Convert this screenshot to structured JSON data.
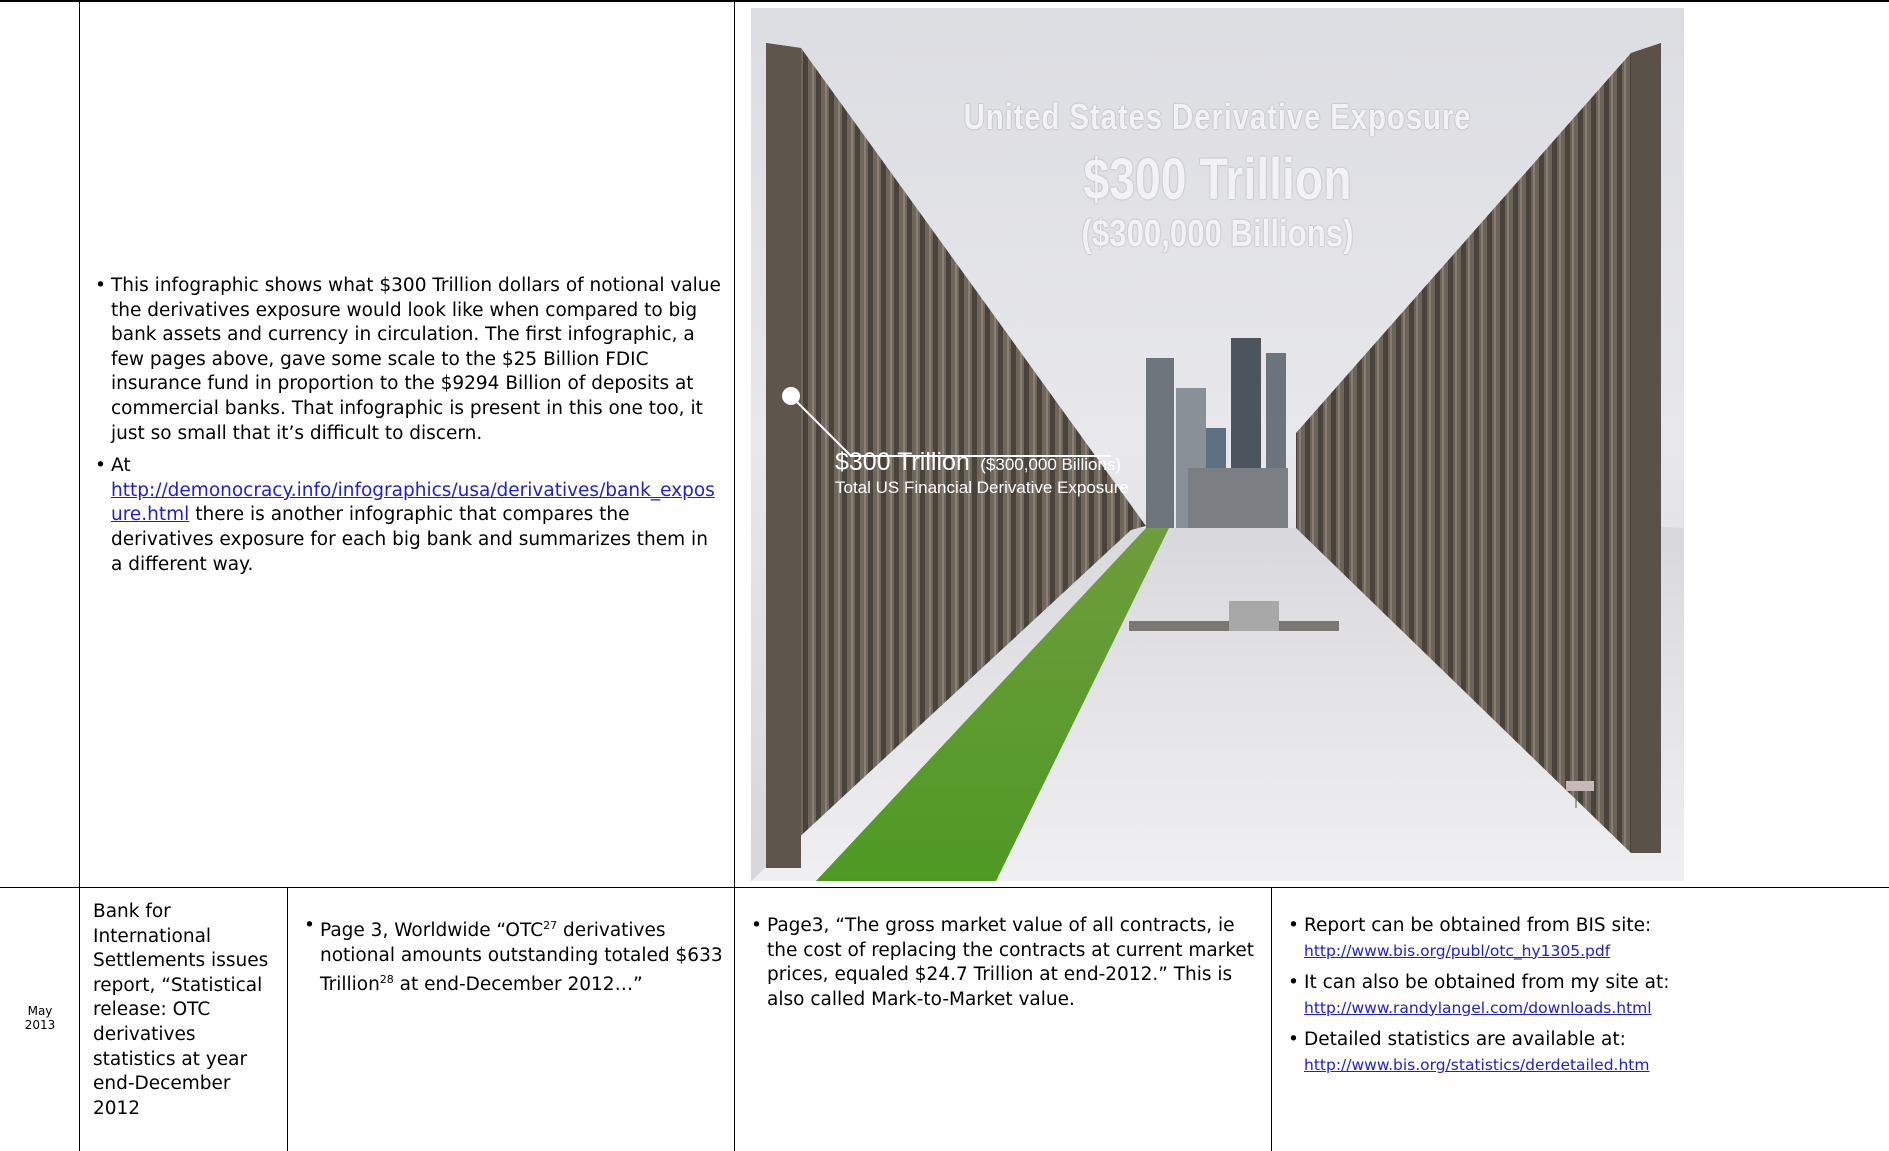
{
  "row1": {
    "bullets": [
      "This infographic shows what $300 Trillion dollars of notional value the derivatives exposure would look like when compared to big bank assets and currency in circulation. The first infographic, a few pages above, gave some scale to the $25 Billion FDIC insurance fund in proportion to the $9294 Billion of deposits at commercial banks. That infographic is present in this one too, it just so small that it’s difficult to discern."
    ],
    "bullet2_prefix": "At",
    "bullet2_link": "http://demonocracy.info/infographics/usa/derivatives/bank_exposure.html",
    "bullet2_suffix": " there is another infographic that compares the derivatives exposure for each big bank and summarizes them in a different way."
  },
  "infographic": {
    "title": "United States Derivative Exposure",
    "amount": "$300 Trillion",
    "amount_billions": "($300,000 Billions)",
    "callout_amount": "$300 Trillion",
    "callout_billions": "($300,000 Billions)",
    "callout_desc": "Total US Financial Derivative Exposure"
  },
  "row2": {
    "date_month": "May",
    "date_year": "2013",
    "event": "Bank for International Settlements issues report, “Statistical release: OTC derivatives statistics at year end-December 2012",
    "col3_pre": "Page 3, Worldwide “OTC",
    "col3_sup1": "27",
    "col3_mid": " derivatives notional amounts outstanding totaled $633 Trillion",
    "col3_sup2": "28",
    "col3_post": " at end-December 2012…”",
    "col4": "Page3, “The gross market value of all contracts, ie the cost of replacing the contracts at current market prices, equaled $24.7 Trillion at end-2012.” This is also called Mark-to-Market value.",
    "col5": [
      {
        "text": "Report can be obtained from BIS site:",
        "link": "http://www.bis.org/publ/otc_hy1305.pdf"
      },
      {
        "text": "It can also be obtained from my site at:",
        "link": "http://www.randylangel.com/downloads.html"
      },
      {
        "text": "Detailed statistics are available at:",
        "link": "http://www.bis.org/statistics/derdetailed.htm"
      }
    ]
  }
}
